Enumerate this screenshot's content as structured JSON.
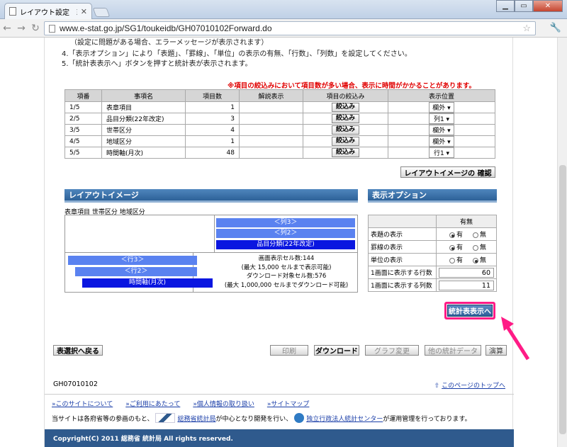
{
  "browser": {
    "tab_title": "レイアウト設定　政府統計",
    "url": "www.e-stat.go.jp/SG1/toukeidb/GH07010102Forward.do"
  },
  "instructions": [
    "（設定に問題がある場合、エラーメッセージが表示されます）",
    "4.「表示オプション」により「表題」、「罫線」、「単位」の表示の有無、「行数」、「列数」を設定してください。",
    "5.「統計表表示へ」ボタンを押すと統計表が表示されます。"
  ],
  "warning": "※項目の絞込みにおいて項目数が多い場合、表示に時間がかかることがあります。",
  "items_table": {
    "headers": [
      "項番",
      "事項名",
      "項目数",
      "解説表示",
      "項目の絞込み",
      "表示位置"
    ],
    "rows": [
      {
        "no": "1/5",
        "name": "表章項目",
        "count": "1",
        "filter": "絞込み",
        "pos": "欄外"
      },
      {
        "no": "2/5",
        "name": "品目分類(22年改定)",
        "count": "3",
        "filter": "絞込み",
        "pos": "列1"
      },
      {
        "no": "3/5",
        "name": "世帯区分",
        "count": "4",
        "filter": "絞込み",
        "pos": "欄外"
      },
      {
        "no": "4/5",
        "name": "地域区分",
        "count": "1",
        "filter": "絞込み",
        "pos": "欄外"
      },
      {
        "no": "5/5",
        "name": "時間軸(月次)",
        "count": "48",
        "filter": "絞込み",
        "pos": "行1"
      }
    ]
  },
  "layout_check_button": "レイアウトイメージの 確認",
  "layout_image": {
    "title": "レイアウトイメージ",
    "caption": "表章項目 世帯区分 地域区分",
    "col3": "＜列3＞",
    "col2": "＜列2＞",
    "col1": "品目分類(22年改定)",
    "row3": "＜行3＞",
    "row2": "＜行2＞",
    "row1": "時間軸(月次)",
    "info1": "画面表示セル数:144",
    "info2": "(最大 15,000 セルまで表示可能)",
    "info3": "ダウンロード対象セル数:576",
    "info4": "(最大 1,000,000 セルまでダウンロード可能)"
  },
  "options": {
    "title": "表示オプション",
    "header": "有無",
    "rows": [
      {
        "label": "表題の表示",
        "on": "有",
        "off": "無",
        "value": "on"
      },
      {
        "label": "罫線の表示",
        "on": "有",
        "off": "無",
        "value": "on"
      },
      {
        "label": "単位の表示",
        "on": "有",
        "off": "無",
        "value": "off"
      }
    ],
    "rows_label": "1画面に表示する行数",
    "rows_value": "60",
    "cols_label": "1画面に表示する列数",
    "cols_value": "11"
  },
  "show_table_button": "統計表表示へ",
  "bottom_buttons": {
    "back": "表選択へ戻る",
    "print": "印刷",
    "download": "ダウンロード",
    "graph": "グラフ変更",
    "other": "他の統計データ",
    "calc": "演算"
  },
  "page_code": "GH07010102",
  "to_top": "このページのトップへ",
  "footer_links": [
    "このサイトについて",
    "ご利用にあたって",
    "個人情報の取り扱い",
    "サイトマップ"
  ],
  "credit": {
    "prefix": "当サイトは各府省等の参画のもと、",
    "link1": "総務省統計局",
    "mid": "が中心となり開発を行い、",
    "link2": "独立行政法人統計センター",
    "suffix": "が運用管理を行っております。"
  },
  "copyright": "Copyright(C) 2011 総務省 統計局 All rights reserved."
}
